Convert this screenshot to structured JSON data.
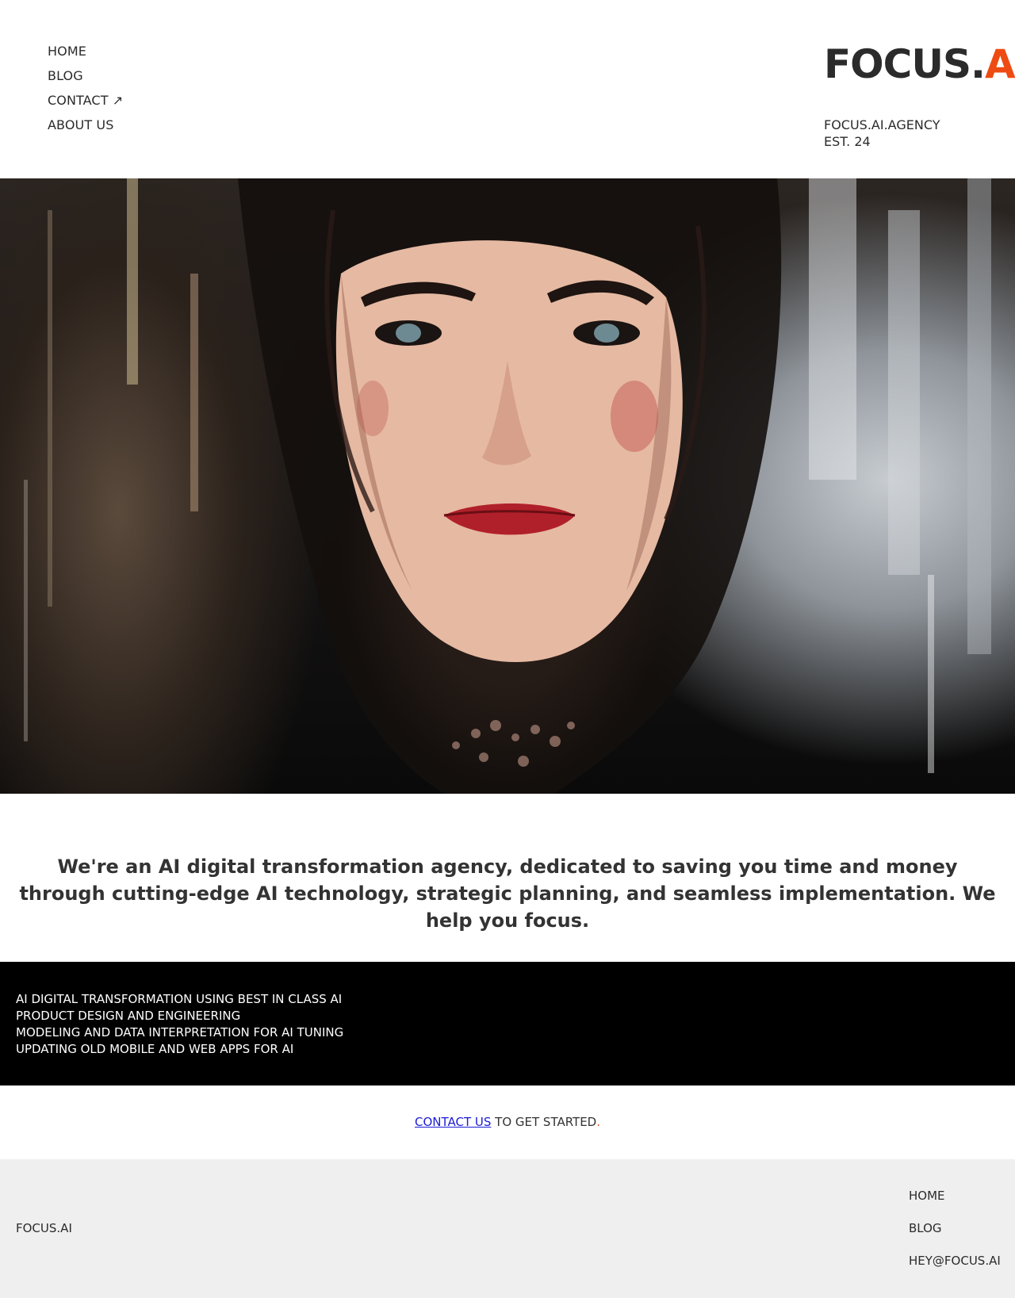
{
  "nav": {
    "items": [
      {
        "label": "HOME"
      },
      {
        "label": "BLOG"
      },
      {
        "label": "CONTACT ↗"
      },
      {
        "label": "ABOUT US"
      }
    ]
  },
  "logo": {
    "main": "FOCUS.",
    "accent": "AI",
    "accent_color": "#ee4b12"
  },
  "meta": {
    "domain": "FOCUS.AI.AGENCY",
    "established": "EST. 24"
  },
  "intro": {
    "text": "We're an AI digital transformation agency, dedicated to saving you time and money through cutting-edge AI technology, strategic planning, and seamless implementation. We help you focus."
  },
  "services": {
    "items": [
      {
        "label": "AI DIGITAL TRANSFORMATION USING BEST IN CLASS AI"
      },
      {
        "label": "PRODUCT DESIGN AND ENGINEERING"
      },
      {
        "label": "MODELING AND DATA INTERPRETATION FOR AI TUNING"
      },
      {
        "label": "UPDATING OLD MOBILE AND WEB APPS FOR AI"
      }
    ]
  },
  "cta": {
    "link_label": "CONTACT US",
    "rest": " TO GET STARTED",
    "period": "."
  },
  "footer": {
    "brand": "FOCUS.AI",
    "links": [
      {
        "label": "HOME"
      },
      {
        "label": "BLOG"
      },
      {
        "label": "HEY@FOCUS.AI"
      }
    ]
  },
  "colors": {
    "accent": "#ee4b12",
    "services_bg": "#000000",
    "footer_bg": "#efefef",
    "link": "#1b1bd6"
  }
}
